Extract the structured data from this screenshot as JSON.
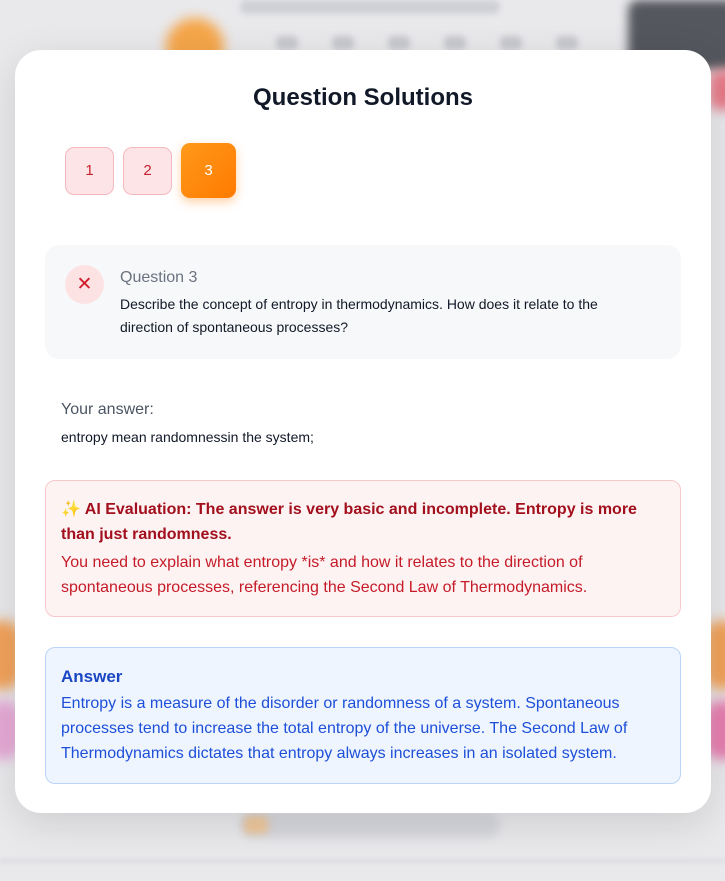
{
  "modal": {
    "title": "Question Solutions",
    "tabs": [
      {
        "label": "1",
        "status": "incorrect"
      },
      {
        "label": "2",
        "status": "incorrect"
      },
      {
        "label": "3",
        "status": "active"
      }
    ],
    "question": {
      "label": "Question 3",
      "text": "Describe the concept of entropy in thermodynamics. How does it relate to the direction of spontaneous processes?",
      "status_icon": "close-icon",
      "status_glyph": "✕"
    },
    "your_answer": {
      "label": "Your answer:",
      "text": "entropy mean randomnessin the system;"
    },
    "evaluation": {
      "icon": "✨",
      "title": "AI Evaluation: The answer is very basic and incomplete. Entropy is more than just randomness.",
      "body": "You need to explain what entropy *is* and how it relates to the direction of spontaneous processes, referencing the Second Law of Thermodynamics."
    },
    "answer": {
      "title": "Answer",
      "body": "Entropy is a measure of the disorder or randomness of a system. Spontaneous processes tend to increase the total entropy of the universe. The Second Law of Thermodynamics dictates that entropy always increases in an isolated system."
    }
  },
  "colors": {
    "accent": "#ff8a00",
    "incorrect": "#c8202c",
    "answer_blue": "#1d4fd8"
  }
}
